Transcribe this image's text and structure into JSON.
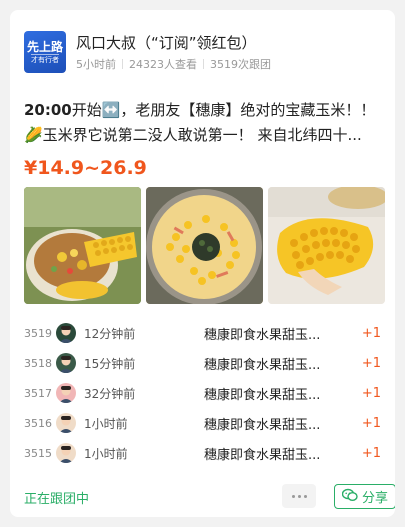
{
  "header": {
    "avatar_line1": "先上路",
    "avatar_line2": "才有行者",
    "author_name": "风口大叔（“订阅”领红包）",
    "posted": "5小时前",
    "views": "24323人查看",
    "follows": "3519次跟团"
  },
  "post": {
    "title_line1_bold": "20:00",
    "title_line1_rest": "开始↔️，老朋友【穗康】绝对的宝藏玉米！！",
    "title_line2": "🌽玉米界它说第二没人敢说第一！ 来自北纬四十...",
    "price": "¥14.9~26.9"
  },
  "images": [
    {
      "name": "corn-bowl-photo"
    },
    {
      "name": "corn-rice-skillet-photo"
    },
    {
      "name": "corn-cob-photo"
    }
  ],
  "follow_list": [
    {
      "index": "3519",
      "time": "12分钟前",
      "product": "穗康即食水果甜玉...",
      "plus": "+1"
    },
    {
      "index": "3518",
      "time": "15分钟前",
      "product": "穗康即食水果甜玉...",
      "plus": "+1"
    },
    {
      "index": "3517",
      "time": "32分钟前",
      "product": "穗康即食水果甜玉...",
      "plus": "+1"
    },
    {
      "index": "3516",
      "time": "1小时前",
      "product": "穗康即食水果甜玉...",
      "plus": "+1"
    },
    {
      "index": "3515",
      "time": "1小时前",
      "product": "穗康即食水果甜玉...",
      "plus": "+1"
    }
  ],
  "footer": {
    "status": "正在跟团中",
    "share_label": "分享"
  },
  "colors": {
    "accent_orange": "#f0561d",
    "accent_green": "#2aae67",
    "avatar_blue": "#2f6de0"
  }
}
